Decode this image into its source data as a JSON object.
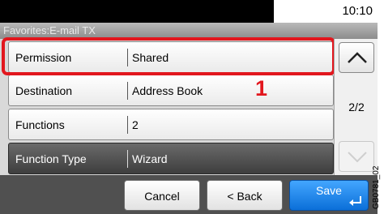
{
  "header": {
    "clock": "10:10",
    "title": "Favorites:E-mail TX"
  },
  "rows": [
    {
      "label": "Permission",
      "value": "Shared"
    },
    {
      "label": "Destination",
      "value": "Address Book"
    },
    {
      "label": "Functions",
      "value": "2"
    },
    {
      "label": "Function Type",
      "value": "Wizard"
    }
  ],
  "highlight": {
    "callout_number": "1",
    "color": "#e2171e"
  },
  "scroll": {
    "page_indicator": "2/2",
    "up_icon": "chevron-up-icon",
    "down_icon": "chevron-down-icon",
    "down_disabled": true
  },
  "footer": {
    "cancel_label": "Cancel",
    "back_label": "< Back",
    "save_label": "Save",
    "save_icon": "enter-return-icon",
    "accent": "#1a82ea"
  },
  "figure_code": "GB0781_02"
}
